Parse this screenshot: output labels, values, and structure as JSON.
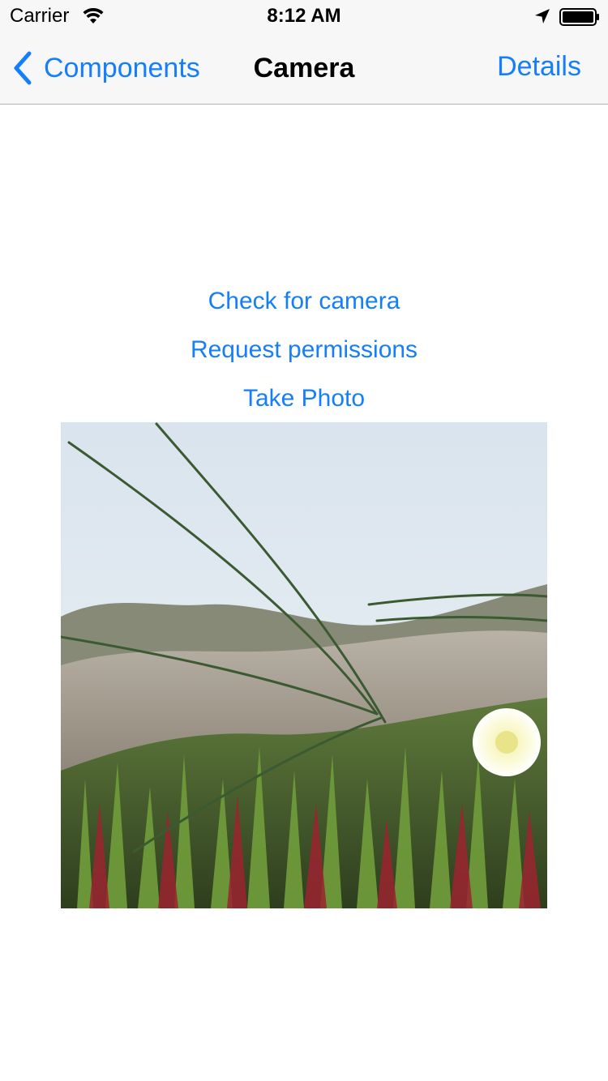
{
  "status_bar": {
    "carrier": "Carrier",
    "time": "8:12 AM",
    "icons": [
      "wifi-icon",
      "location-arrow-icon",
      "battery-icon"
    ]
  },
  "nav": {
    "back_label": "Components",
    "title": "Camera",
    "right_label": "Details",
    "icons": [
      "chevron-left-icon"
    ]
  },
  "actions": {
    "check_camera": "Check for camera",
    "request_permissions": "Request permissions",
    "take_photo": "Take Photo"
  },
  "colors": {
    "accent": "#147efb",
    "bar_background": "#f7f7f7"
  }
}
